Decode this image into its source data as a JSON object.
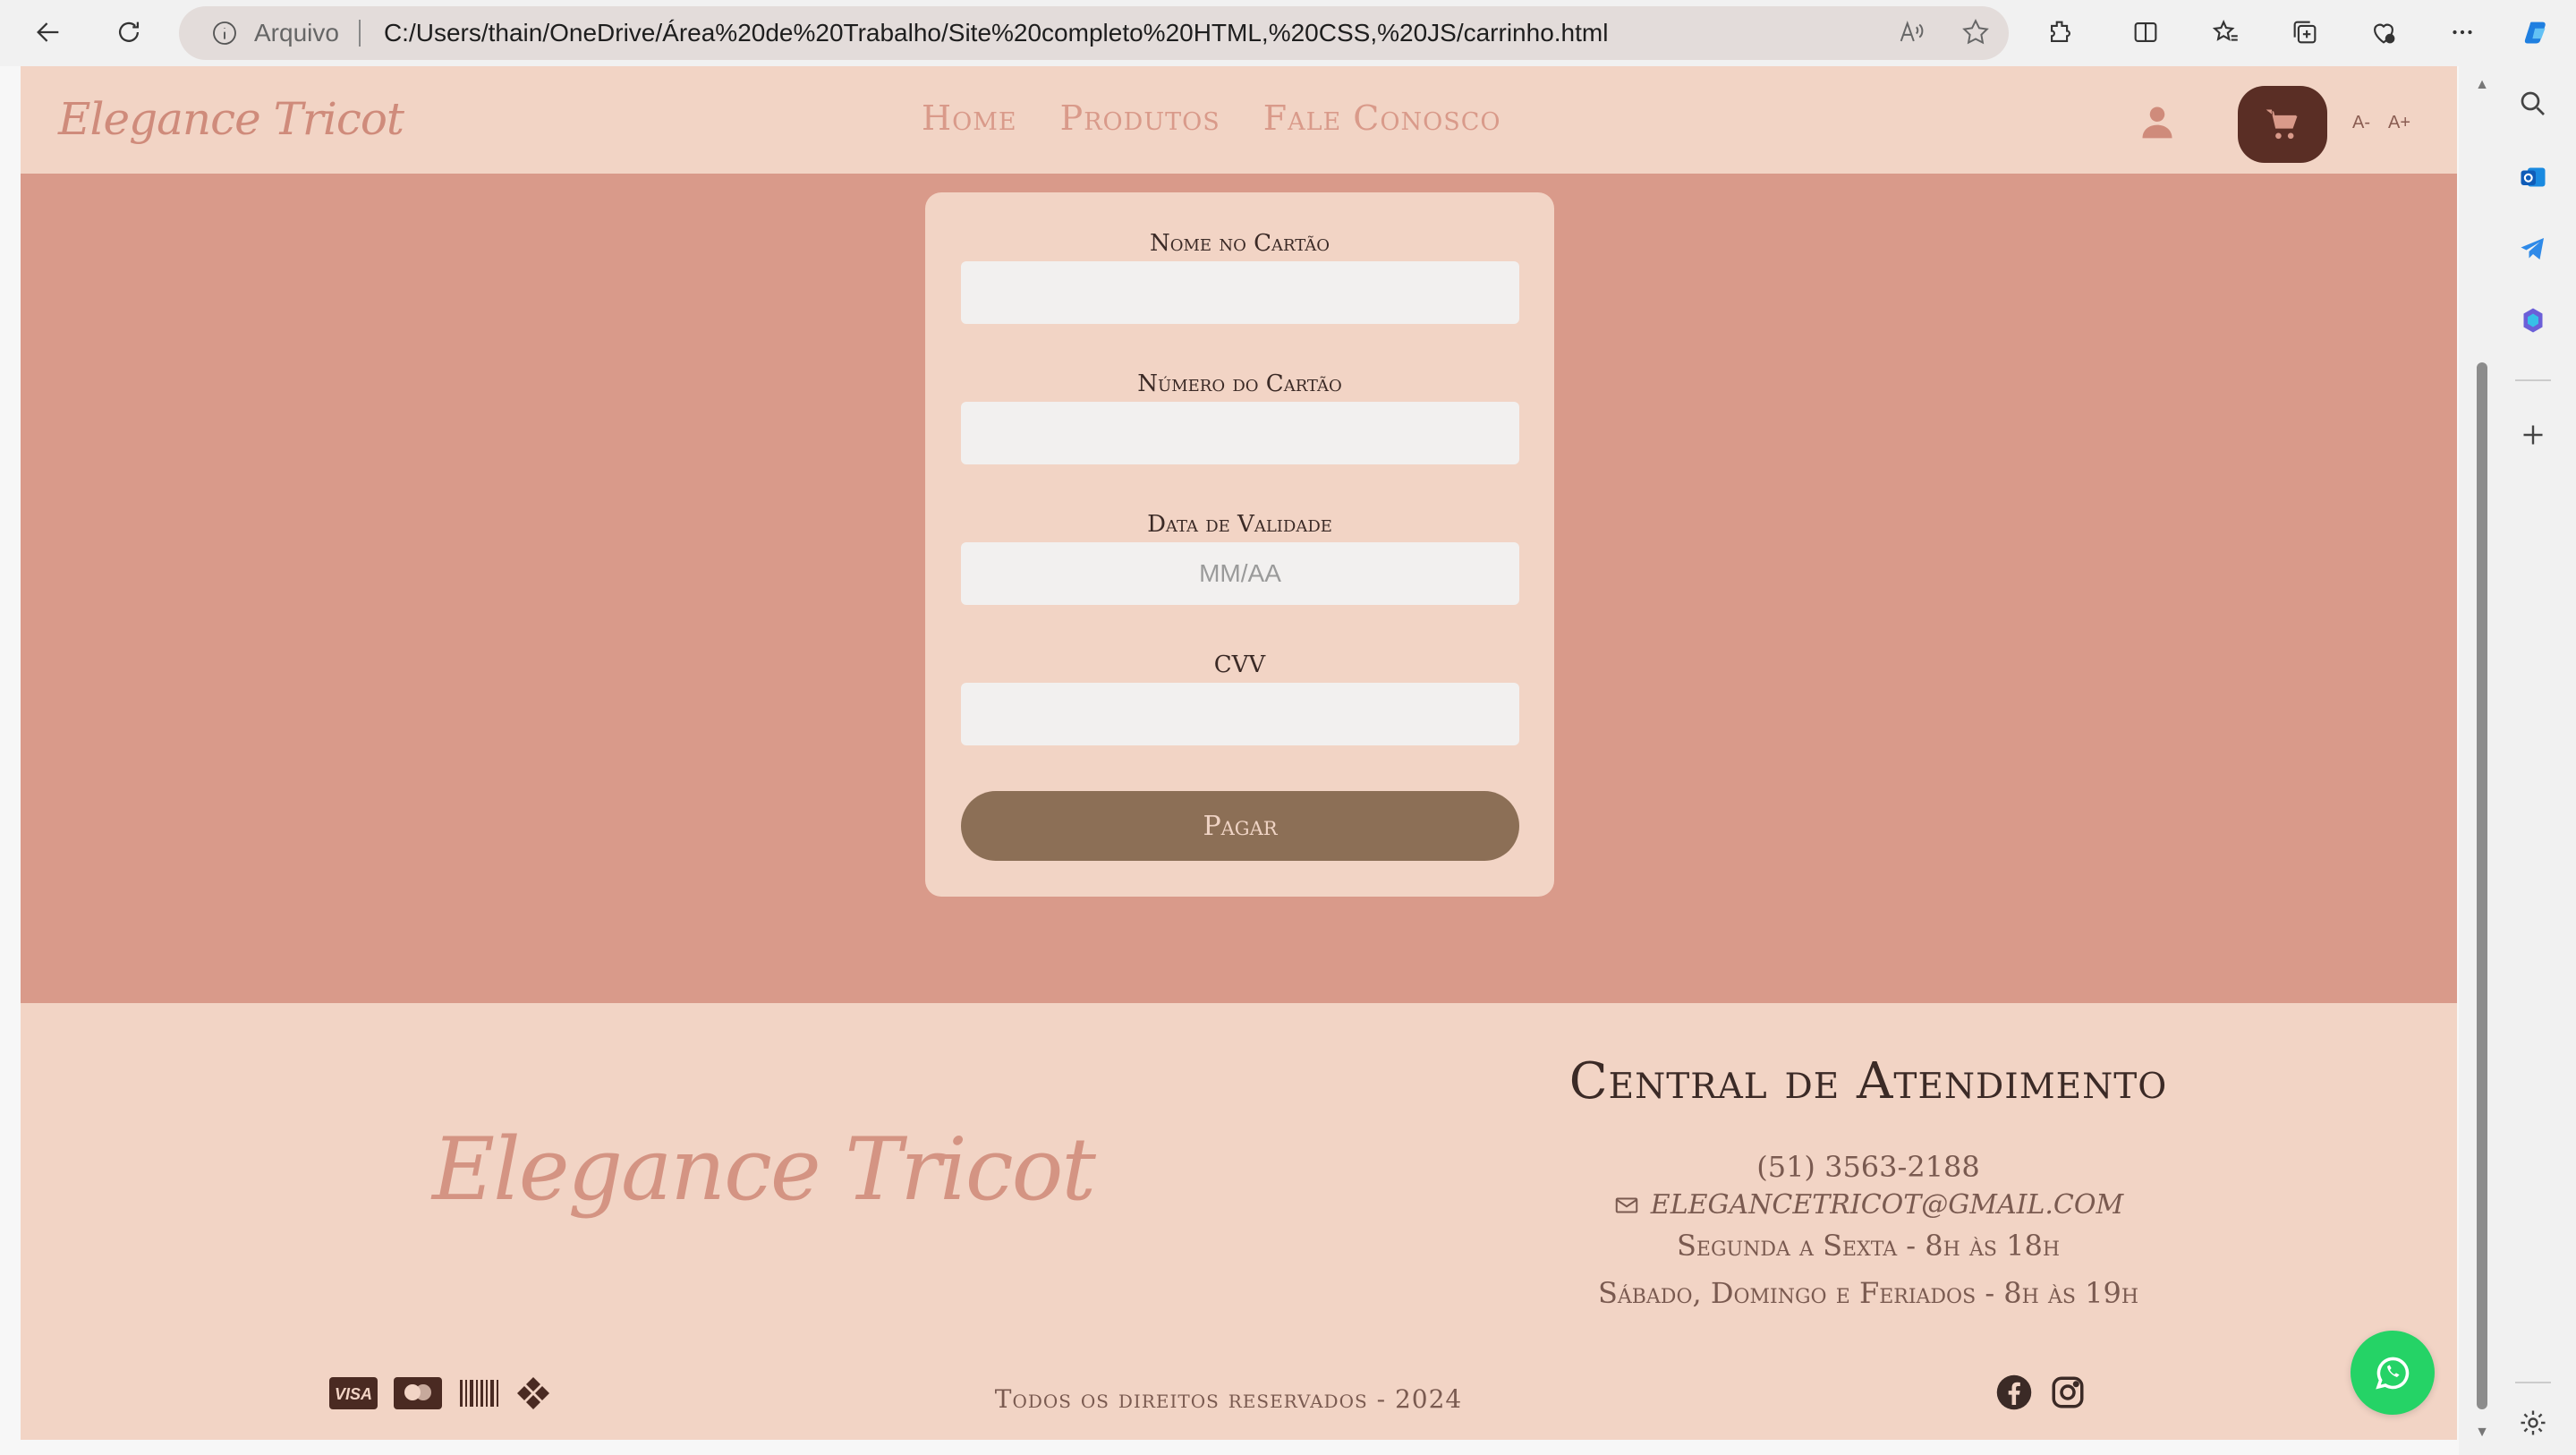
{
  "browser": {
    "address_label": "Arquivo",
    "url": "C:/Users/thain/OneDrive/Área%20de%20Trabalho/Site%20completo%20HTML,%20CSS,%20JS/carrinho.html"
  },
  "site": {
    "brand": "Elegance Tricot",
    "nav": [
      "Home",
      "Produtos",
      "Fale Conosco"
    ],
    "font_decrease": "A-",
    "font_increase": "A+"
  },
  "payment_form": {
    "name_label": "Nome no Cartão",
    "name_value": "",
    "number_label": "Número do Cartão",
    "number_value": "",
    "expiry_label": "Data de Validade",
    "expiry_placeholder": "MM/AA",
    "cvv_label": "CVV",
    "cvv_value": "",
    "submit_label": "Pagar"
  },
  "footer": {
    "brand": "Elegance Tricot",
    "central_title": "Central de Atendimento",
    "phone": "(51) 3563-2188",
    "email": "ELEGANCETRICOT@GMAIL.COM",
    "hours_weekdays": "Segunda a Sexta - 8h às 18h",
    "hours_weekend": "Sábado, Domingo e Feriados - 8h às 19h",
    "copyright": "Todos os direitos reservados - 2024",
    "payment_icons": [
      "visa-icon",
      "mastercard-icon",
      "barcode-icon",
      "pix-icon"
    ],
    "social_icons": [
      "facebook-icon",
      "instagram-icon"
    ]
  },
  "colors": {
    "page_bg": "#d99a8a",
    "header_bg": "#f2d4c5",
    "accent": "#cf8b7b",
    "cart_bg": "#5a2e25",
    "pay_button": "#8c6f56",
    "whatsapp": "#25d366"
  }
}
